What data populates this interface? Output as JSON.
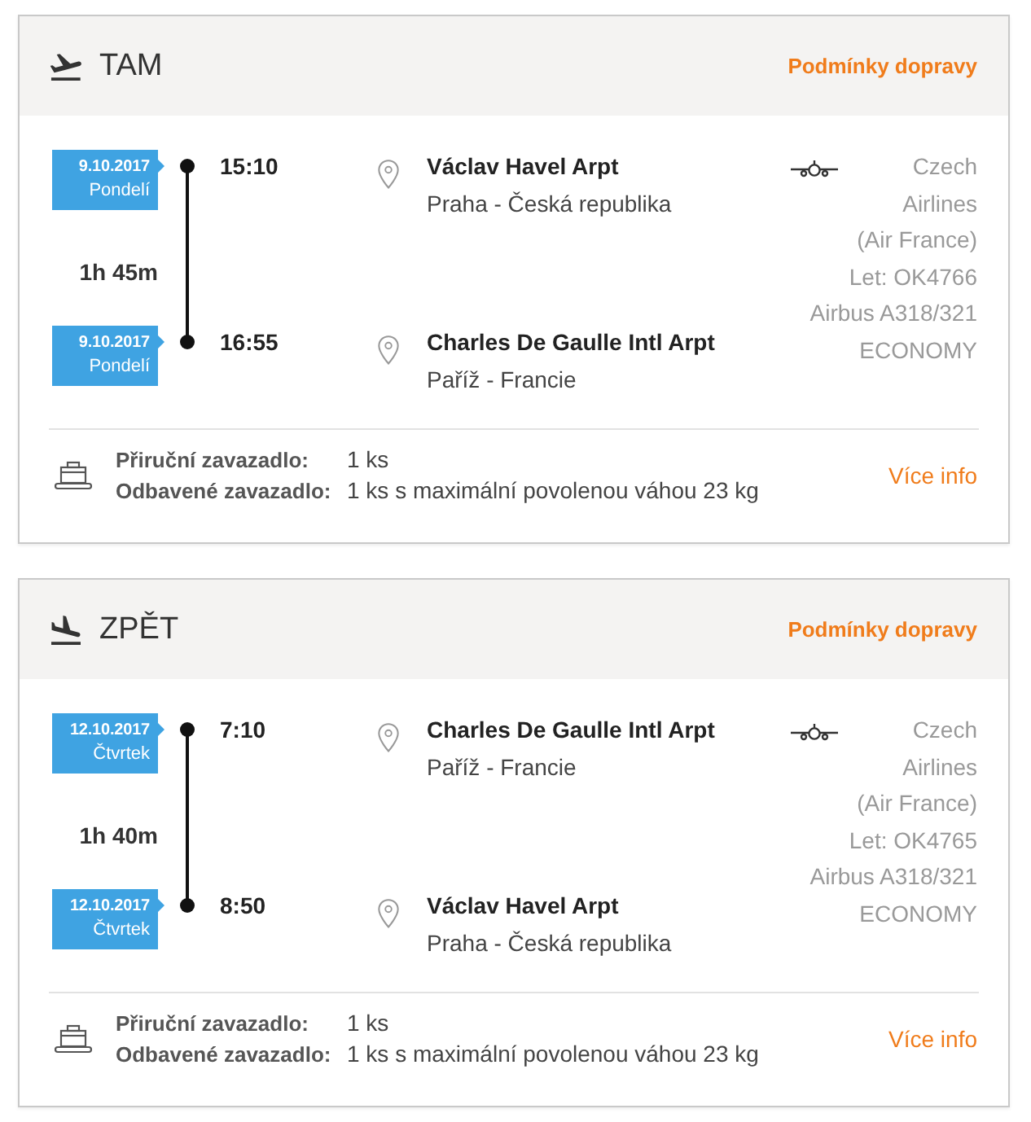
{
  "legs": [
    {
      "kind": "departure",
      "title": "TAM",
      "conditions_link": "Podmínky dopravy",
      "stops": [
        {
          "date": "9.10.2017",
          "weekday": "Pondelí",
          "time": "15:10",
          "airport": "Václav Havel Arpt",
          "city": "Praha - Česká republika"
        },
        {
          "date": "9.10.2017",
          "weekday": "Pondelí",
          "time": "16:55",
          "airport": "Charles De Gaulle Intl Arpt",
          "city": "Paříž - Francie"
        }
      ],
      "duration": "1h 45m",
      "carrier": {
        "airline": "Czech Airlines",
        "operator": "(Air France)",
        "flight": "Let: OK4766",
        "aircraft": "Airbus A318/321",
        "cabin": "ECONOMY"
      },
      "baggage": [
        {
          "label": "Přiruční zavazadlo:",
          "value": "1 ks"
        },
        {
          "label": "Odbavené zavazadlo:",
          "value": "1 ks s maximální povolenou váhou 23 kg"
        }
      ],
      "more_link": "Více info"
    },
    {
      "kind": "arrival",
      "title": "ZPĚT",
      "conditions_link": "Podmínky dopravy",
      "stops": [
        {
          "date": "12.10.2017",
          "weekday": "Čtvrtek",
          "time": "7:10",
          "airport": "Charles De Gaulle Intl Arpt",
          "city": "Paříž - Francie"
        },
        {
          "date": "12.10.2017",
          "weekday": "Čtvrtek",
          "time": "8:50",
          "airport": "Václav Havel Arpt",
          "city": "Praha - Česká republika"
        }
      ],
      "duration": "1h 40m",
      "carrier": {
        "airline": "Czech Airlines",
        "operator": "(Air France)",
        "flight": "Let: OK4765",
        "aircraft": "Airbus A318/321",
        "cabin": "ECONOMY"
      },
      "baggage": [
        {
          "label": "Přiruční zavazadlo:",
          "value": "1 ks"
        },
        {
          "label": "Odbavené zavazadlo:",
          "value": "1 ks s maximální povolenou váhou 23 kg"
        }
      ],
      "more_link": "Více info"
    }
  ]
}
